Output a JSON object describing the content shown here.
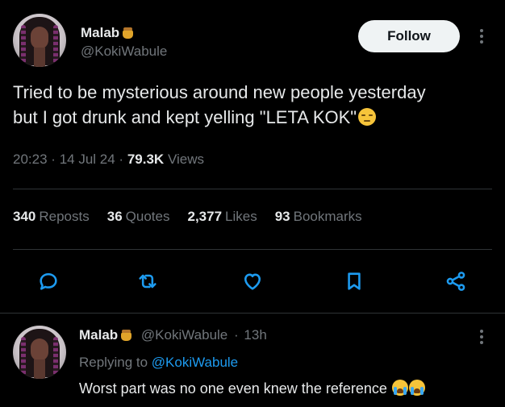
{
  "post": {
    "display_name": "Malab",
    "handle": "@KokiWabule",
    "follow_label": "Follow",
    "text_line1": "Tried to be mysterious around new people yesterday",
    "text_line2": "but I got drunk and kept yelling \"LETA KOK\"",
    "time": "20:23",
    "date": "14 Jul 24",
    "views_count": "79.3K",
    "views_label": "Views",
    "separator": "·"
  },
  "stats": [
    {
      "count": "340",
      "label": "Reposts"
    },
    {
      "count": "36",
      "label": "Quotes"
    },
    {
      "count": "2,377",
      "label": "Likes"
    },
    {
      "count": "93",
      "label": "Bookmarks"
    }
  ],
  "actions": [
    "reply-icon",
    "repost-icon",
    "like-icon",
    "bookmark-icon",
    "share-icon"
  ],
  "reply": {
    "display_name": "Malab",
    "handle": "@KokiWabule",
    "time": "13h",
    "separator": "·",
    "replying_prefix": "Replying to",
    "replying_to": "@KokiWabule",
    "text": "Worst part was no one even knew the reference"
  },
  "colors": {
    "background": "#000000",
    "text": "#e7e9ea",
    "secondary": "#71767b",
    "accent": "#1d9bf0",
    "divider": "#2f3336"
  }
}
